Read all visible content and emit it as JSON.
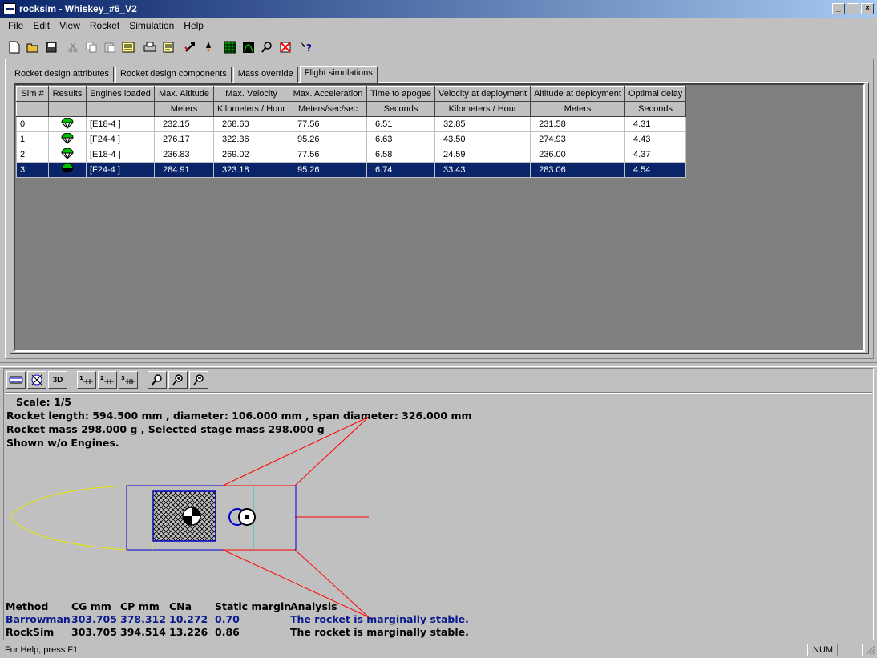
{
  "window": {
    "title": "rocksim - Whiskey_#6_V2"
  },
  "menu": [
    "File",
    "Edit",
    "View",
    "Rocket",
    "Simulation",
    "Help"
  ],
  "toolbar_icons": [
    "new-icon",
    "open-icon",
    "save-icon",
    "cut-icon",
    "copy-icon",
    "paste-icon",
    "properties-icon",
    "print-icon",
    "report-icon",
    "rocket-tools-icon",
    "rocket-ignite-icon",
    "grid-icon",
    "chart-icon",
    "find-icon",
    "delete-icon",
    "help-icon"
  ],
  "tabs": [
    {
      "label": "Rocket design attributes",
      "active": false
    },
    {
      "label": "Rocket design components",
      "active": false
    },
    {
      "label": "Mass override",
      "active": false
    },
    {
      "label": "Flight simulations",
      "active": true
    }
  ],
  "table": {
    "headers": [
      "Sim #",
      "Results",
      "Engines loaded",
      "Max. Altitude",
      "Max. Velocity",
      "Max. Acceleration",
      "Time to apogee",
      "Velocity at deployment",
      "Altitude at deployment",
      "Optimal delay"
    ],
    "units": [
      "",
      "",
      "",
      "Meters",
      "Kilometers / Hour",
      "Meters/sec/sec",
      "Seconds",
      "Kilometers / Hour",
      "Meters",
      "Seconds"
    ],
    "rows": [
      [
        "0",
        "",
        "[E18-4   ]",
        "232.15",
        "268.60",
        "77.56",
        "6.51",
        "32.85",
        "231.58",
        "4.31"
      ],
      [
        "1",
        "",
        "[F24-4   ]",
        "276.17",
        "322.36",
        "95.26",
        "6.63",
        "43.50",
        "274.93",
        "4.43"
      ],
      [
        "2",
        "",
        "[E18-4   ]",
        "236.83",
        "269.02",
        "77.56",
        "6.58",
        "24.59",
        "236.00",
        "4.37"
      ],
      [
        "3",
        "",
        "[F24-4   ]",
        "284.91",
        "323.18",
        "95.26",
        "6.74",
        "33.43",
        "283.06",
        "4.54"
      ]
    ],
    "selected_row": 3
  },
  "info": {
    "scale": "Scale: 1/5",
    "length": "Rocket length: 594.500  mm , diameter: 106.000  mm , span diameter: 326.000  mm",
    "mass": "Rocket mass 298.000 g , Selected stage mass 298.000 g",
    "engines": "Shown w/o Engines."
  },
  "stability": {
    "headers": [
      "Method",
      "CG mm",
      "CP mm",
      "CNa",
      "Static margin",
      "Analysis"
    ],
    "rows": [
      [
        "Barrowman",
        "303.705",
        "378.312",
        "10.272",
        "0.70",
        "The rocket is marginally stable."
      ],
      [
        "RockSim",
        "303.705",
        "394.514",
        "13.226",
        "0.86",
        "The rocket is marginally stable."
      ]
    ]
  },
  "status": {
    "text": "For Help, press F1",
    "num": "NUM"
  },
  "colors": {
    "title_bar": "#0a246a",
    "selection": "#0a246a",
    "body_tube": "#0000cc",
    "fins": "#ff0000",
    "nose_cone": "#e6e600"
  }
}
